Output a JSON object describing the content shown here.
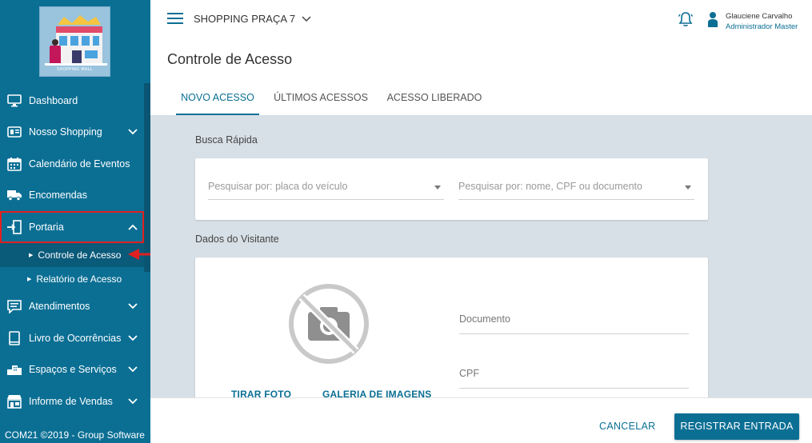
{
  "sidebar": {
    "logo_text": "SHOPPING MALL",
    "items": [
      {
        "label": "Dashboard",
        "icon": "monitor-icon",
        "expandable": false
      },
      {
        "label": "Nosso Shopping",
        "icon": "id-card-icon",
        "expandable": true,
        "expanded": false
      },
      {
        "label": "Calendário de Eventos",
        "icon": "calendar-icon",
        "expandable": false
      },
      {
        "label": "Encomendas",
        "icon": "truck-icon",
        "expandable": false
      },
      {
        "label": "Portaria",
        "icon": "door-enter-icon",
        "expandable": true,
        "expanded": true,
        "highlighted": true
      },
      {
        "label": "Atendimentos",
        "icon": "chat-icon",
        "expandable": true,
        "expanded": false
      },
      {
        "label": "Livro de Ocorrências",
        "icon": "book-icon",
        "expandable": true,
        "expanded": false
      },
      {
        "label": "Espaços e Serviços",
        "icon": "building-icon",
        "expandable": true,
        "expanded": false
      },
      {
        "label": "Informe de Vendas",
        "icon": "store-icon",
        "expandable": true,
        "expanded": false
      }
    ],
    "portaria_sub": [
      {
        "label": "Controle de Acesso",
        "active": true
      },
      {
        "label": "Relatório de Acesso",
        "active": false
      }
    ],
    "footer": "COM21 ©2019 - Group Software"
  },
  "topbar": {
    "mall_name": "SHOPPING PRAÇA 7",
    "user_name": "Glauciene Carvalho",
    "user_role": "Administrador Master"
  },
  "page": {
    "title": "Controle de Acesso",
    "tabs": [
      "NOVO ACESSO",
      "ÚLTIMOS ACESSOS",
      "ACESSO LIBERADO"
    ],
    "active_tab": 0
  },
  "quick_search": {
    "label": "Busca Rápida",
    "vehicle_placeholder": "Pesquisar por: placa do veículo",
    "person_placeholder": "Pesquisar por: nome, CPF ou documento"
  },
  "visitor": {
    "label": "Dados do Visitante",
    "take_photo": "TIRAR FOTO",
    "gallery": "GALERIA DE IMAGENS",
    "document_label": "Documento",
    "cpf_label": "CPF"
  },
  "actions": {
    "cancel": "CANCELAR",
    "submit": "REGISTRAR ENTRADA"
  },
  "colors": {
    "primary": "#0b6f94",
    "content_bg": "#d7e0e6",
    "highlight": "#e02020"
  }
}
